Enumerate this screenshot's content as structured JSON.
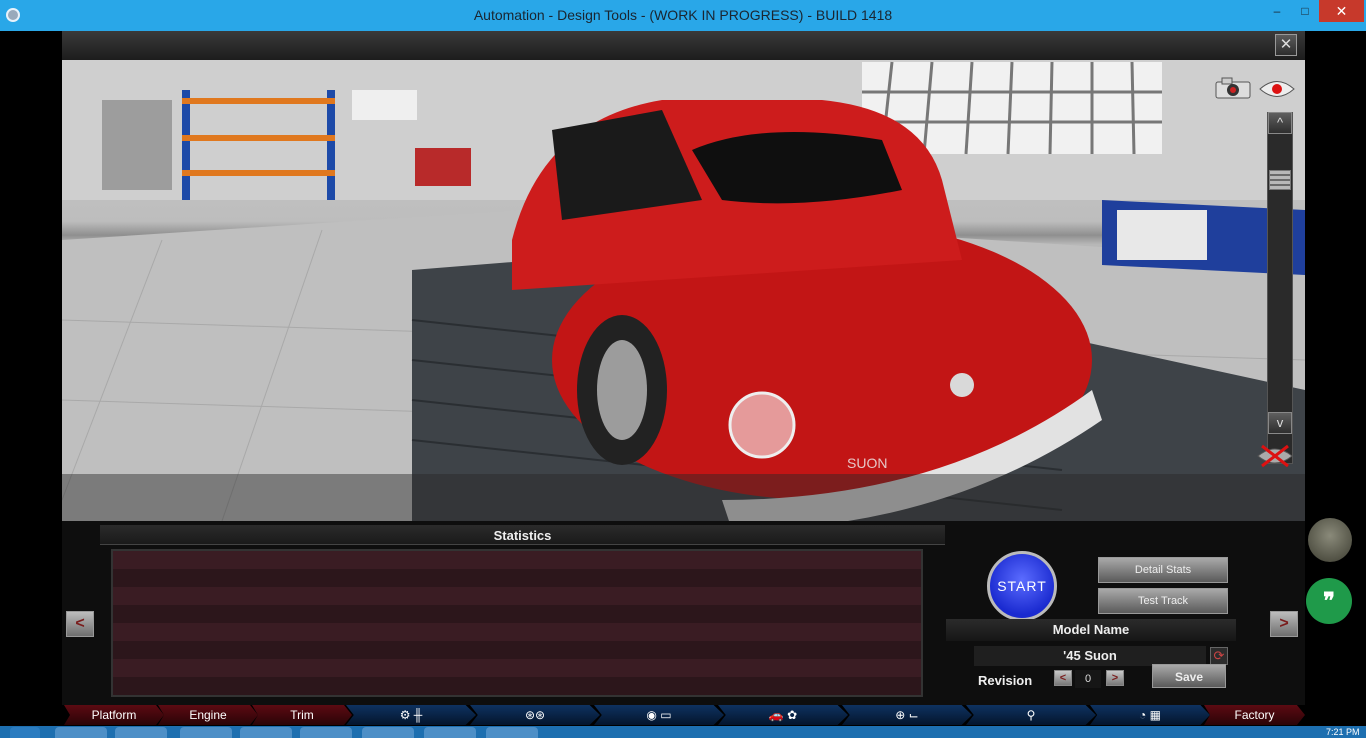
{
  "window": {
    "title": "Automation - Design Tools - (WORK IN PROGRESS) - BUILD 1418",
    "minimize": "–",
    "maximize": "□",
    "close": "✕"
  },
  "app": {
    "close_label": "✕",
    "viewport": {
      "scroll_up": "^",
      "scroll_down": "v",
      "plate_text": "SUON"
    },
    "statistics": {
      "title": "Statistics",
      "prev": "<",
      "next": ">"
    },
    "actions": {
      "start": "START",
      "detail_stats": "Detail Stats",
      "test_track": "Test Track",
      "model_name_label": "Model Name",
      "model_name": "'45 Suon",
      "revision_label": "Revision",
      "revision_value": "0",
      "rev_prev": "<",
      "rev_next": ">",
      "save": "Save"
    },
    "tabs": [
      {
        "label": "Platform"
      },
      {
        "label": "Engine"
      },
      {
        "label": "Trim"
      },
      {
        "label": "⚙ ╫"
      },
      {
        "label": "⊛⊛"
      },
      {
        "label": "◉ ▭"
      },
      {
        "label": "🚗 ✿"
      },
      {
        "label": "⊕ ⌙"
      },
      {
        "label": "⚲"
      },
      {
        "label": "◔ ▦"
      },
      {
        "label": "Factory"
      }
    ]
  },
  "taskbar": {
    "clock": "7:21 PM"
  }
}
